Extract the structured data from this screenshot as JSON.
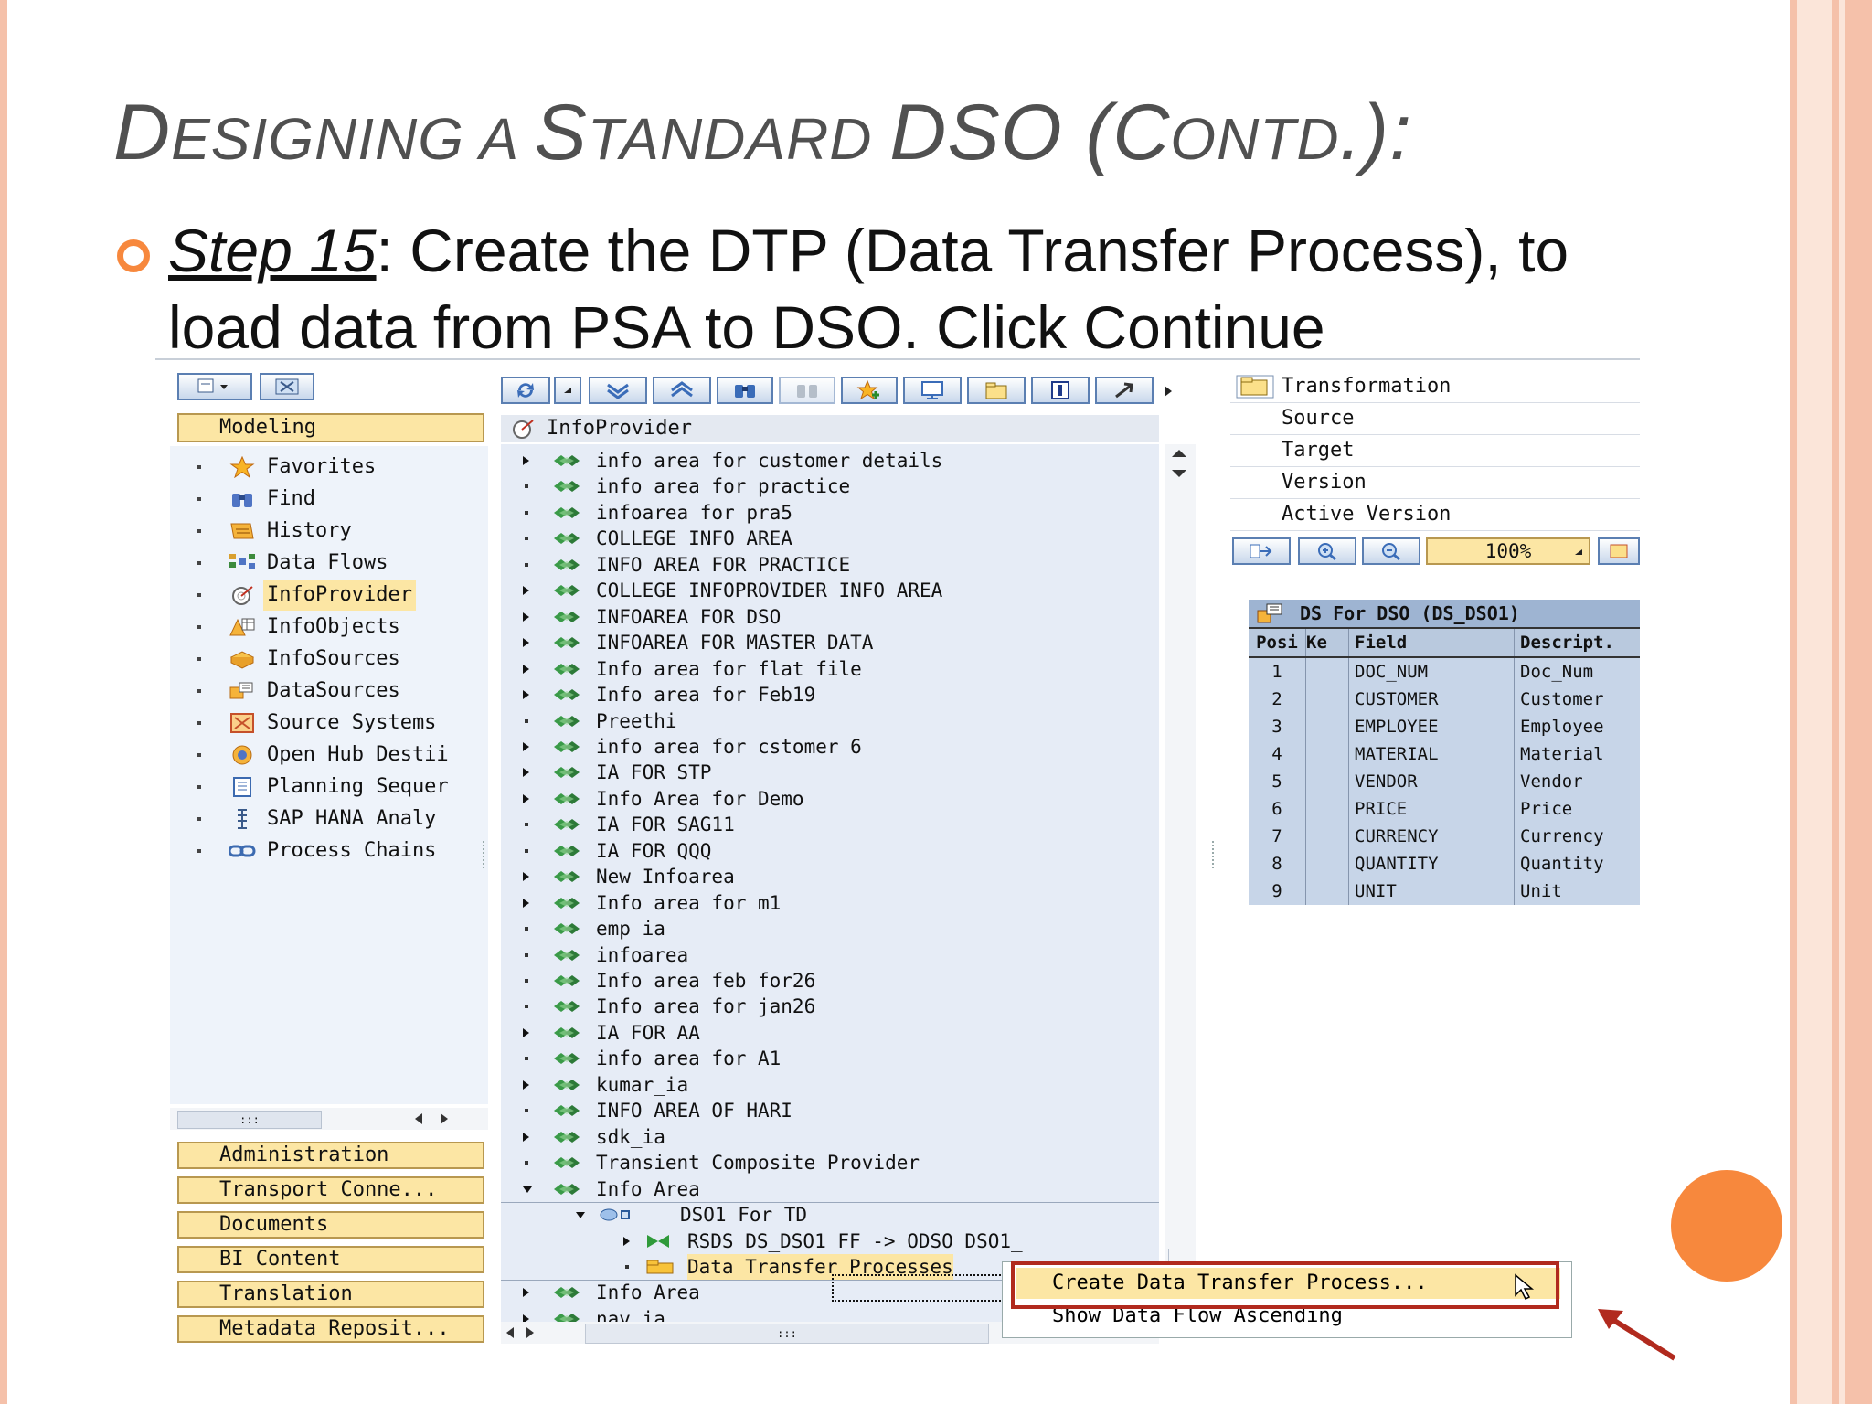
{
  "slide": {
    "title_parts": [
      "D",
      "ESIGNING A ",
      "S",
      "TANDARD ",
      "DSO (C",
      "ONTD",
      ".):"
    ],
    "step_label": "Step 15",
    "step_text": ": Create the DTP (Data Transfer Process), to load data from PSA to DSO. Click Continue"
  },
  "left_pane": {
    "header": "Modeling",
    "items": [
      {
        "label": "Favorites",
        "icon": "star-icon"
      },
      {
        "label": "Find",
        "icon": "binoculars-icon"
      },
      {
        "label": "History",
        "icon": "history-icon"
      },
      {
        "label": "Data Flows",
        "icon": "dataflow-icon"
      },
      {
        "label": "InfoProvider",
        "icon": "infoprovider-icon"
      },
      {
        "label": "InfoObjects",
        "icon": "infoobjects-icon"
      },
      {
        "label": "InfoSources",
        "icon": "infosources-icon"
      },
      {
        "label": "DataSources",
        "icon": "datasources-icon"
      },
      {
        "label": "Source Systems",
        "icon": "source-systems-icon"
      },
      {
        "label": "Open Hub Destii",
        "icon": "open-hub-icon"
      },
      {
        "label": "Planning Sequer",
        "icon": "planning-icon"
      },
      {
        "label": "SAP HANA Analy",
        "icon": "hana-icon"
      },
      {
        "label": "Process Chains",
        "icon": "process-chains-icon"
      }
    ],
    "bottom_buttons": [
      "Administration",
      "Transport Conne...",
      "Documents",
      "BI Content",
      "Translation",
      "Metadata Reposit..."
    ],
    "scroll_grip": ":::"
  },
  "mid_pane": {
    "header": "InfoProvider",
    "rows": [
      {
        "label": "info area for customer details",
        "level": 0,
        "expander": "closed"
      },
      {
        "label": "info area for practice",
        "level": 0,
        "expander": "leaf"
      },
      {
        "label": "infoarea for pra5",
        "level": 0,
        "expander": "leaf"
      },
      {
        "label": "COLLEGE INFO AREA",
        "level": 0,
        "expander": "leaf"
      },
      {
        "label": "INFO AREA FOR PRACTICE",
        "level": 0,
        "expander": "leaf"
      },
      {
        "label": "COLLEGE INFOPROVIDER INFO AREA",
        "level": 0,
        "expander": "closed"
      },
      {
        "label": "INFOAREA FOR DSO",
        "level": 0,
        "expander": "closed"
      },
      {
        "label": "INFOAREA FOR MASTER DATA",
        "level": 0,
        "expander": "closed"
      },
      {
        "label": "Info area for flat file",
        "level": 0,
        "expander": "closed"
      },
      {
        "label": "Info area for Feb19",
        "level": 0,
        "expander": "closed"
      },
      {
        "label": "Preethi",
        "level": 0,
        "expander": "leaf"
      },
      {
        "label": "info area for cstomer 6",
        "level": 0,
        "expander": "closed"
      },
      {
        "label": "IA FOR STP",
        "level": 0,
        "expander": "closed"
      },
      {
        "label": "Info Area for Demo",
        "level": 0,
        "expander": "closed"
      },
      {
        "label": "IA FOR SAG11",
        "level": 0,
        "expander": "leaf"
      },
      {
        "label": "IA FOR QQQ",
        "level": 0,
        "expander": "leaf"
      },
      {
        "label": "New Infoarea",
        "level": 0,
        "expander": "closed"
      },
      {
        "label": "Info area for m1",
        "level": 0,
        "expander": "closed"
      },
      {
        "label": "emp ia",
        "level": 0,
        "expander": "leaf"
      },
      {
        "label": "infoarea",
        "level": 0,
        "expander": "leaf"
      },
      {
        "label": "Info area feb for26",
        "level": 0,
        "expander": "leaf"
      },
      {
        "label": "Info area for jan26",
        "level": 0,
        "expander": "leaf"
      },
      {
        "label": "IA FOR AA",
        "level": 0,
        "expander": "closed"
      },
      {
        "label": "info area for A1",
        "level": 0,
        "expander": "leaf"
      },
      {
        "label": "kumar_ia",
        "level": 0,
        "expander": "closed"
      },
      {
        "label": "INFO AREA OF HARI",
        "level": 0,
        "expander": "leaf"
      },
      {
        "label": "sdk_ia",
        "level": 0,
        "expander": "closed"
      },
      {
        "label": "Transient Composite Provider",
        "level": 0,
        "expander": "leaf"
      },
      {
        "label": "Info Area",
        "level": 0,
        "expander": "open"
      },
      {
        "label": "DSO1 For TD",
        "level": 1,
        "expander": "open"
      },
      {
        "label": "RSDS DS_DSO1 FF -> ODSO DSO1_",
        "level": 2,
        "expander": "closed"
      },
      {
        "label": "Data Transfer Processes",
        "level": 2,
        "expander": "leaf"
      },
      {
        "label": "Info Area",
        "level": 0,
        "expander": "closed"
      },
      {
        "label": "nav ia",
        "level": 0,
        "expander": "closed"
      }
    ],
    "scroll_grip": ":::"
  },
  "right_pane": {
    "transformation_rows": [
      "Transformation",
      "Source",
      "Target",
      "Version",
      "Active Version"
    ],
    "zoom": "100%",
    "table": {
      "title": "DS For DSO (DS_DSO1)",
      "columns": [
        "Posi",
        "Ke",
        "Field",
        "Descript."
      ],
      "rows": [
        [
          "1",
          "",
          "DOC_NUM",
          "Doc_Num"
        ],
        [
          "2",
          "",
          "CUSTOMER",
          "Customer"
        ],
        [
          "3",
          "",
          "EMPLOYEE",
          "Employee"
        ],
        [
          "4",
          "",
          "MATERIAL",
          "Material"
        ],
        [
          "5",
          "",
          "VENDOR",
          "Vendor"
        ],
        [
          "6",
          "",
          "PRICE",
          "Price"
        ],
        [
          "7",
          "",
          "CURRENCY",
          "Currency"
        ],
        [
          "8",
          "",
          "QUANTITY",
          "Quantity"
        ],
        [
          "9",
          "",
          "UNIT",
          "Unit"
        ]
      ]
    }
  },
  "context_menu": {
    "items": [
      "Create Data Transfer Process...",
      "Show Data Flow Ascending"
    ]
  },
  "colors": {
    "accent": "#f7883d",
    "highlight_red": "#b12a1e",
    "sap_yellow": "#fce6a4",
    "tree_bg": "#e6ecf6"
  }
}
